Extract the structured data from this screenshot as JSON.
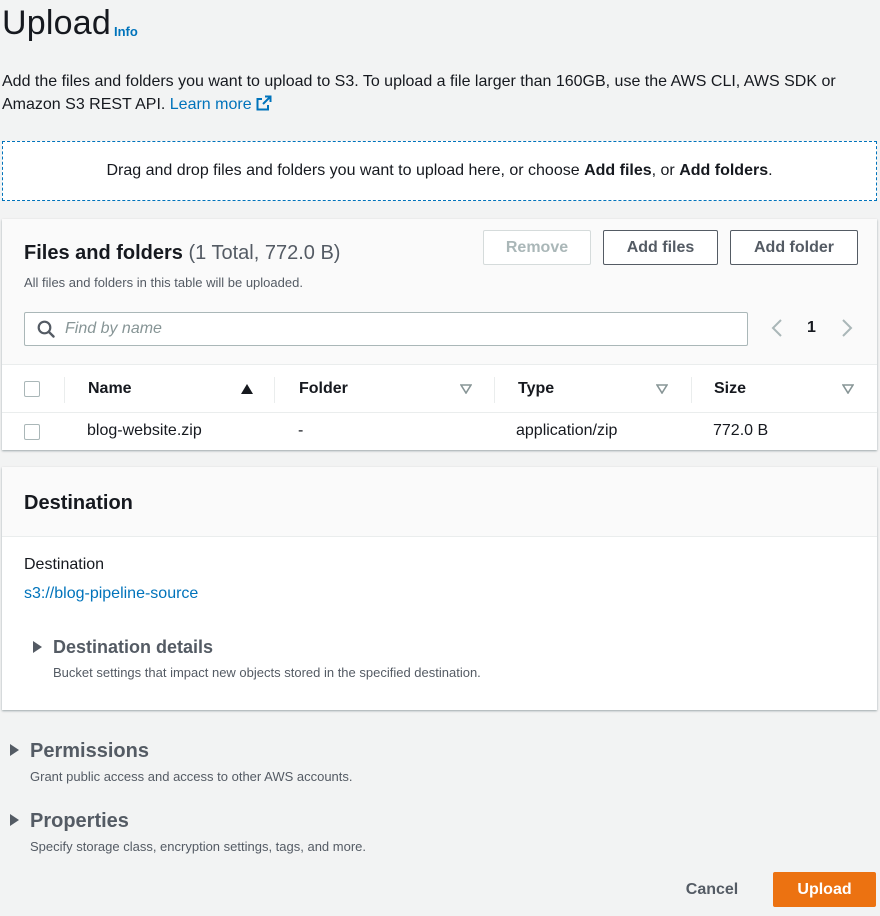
{
  "header": {
    "title": "Upload",
    "info_label": "Info"
  },
  "intro": {
    "text": "Add the files and folders you want to upload to S3. To upload a file larger than 160GB, use the AWS CLI, AWS SDK or Amazon S3 REST API. ",
    "learn_more": "Learn more"
  },
  "dropzone": {
    "text_before": "Drag and drop files and folders you want to upload here, or choose ",
    "add_files": "Add files",
    "text_middle": ", or ",
    "add_folders": "Add folders",
    "text_after": "."
  },
  "files_panel": {
    "title": "Files and folders",
    "count": "(1 Total, 772.0 B)",
    "description": "All files and folders in this table will be uploaded.",
    "remove_label": "Remove",
    "add_files_label": "Add files",
    "add_folder_label": "Add folder",
    "search_placeholder": "Find by name",
    "page_number": "1",
    "columns": [
      "Name",
      "Folder",
      "Type",
      "Size"
    ],
    "rows": [
      {
        "name": "blog-website.zip",
        "folder": "-",
        "type": "application/zip",
        "size": "772.0 B"
      }
    ]
  },
  "destination_panel": {
    "title": "Destination",
    "label": "Destination",
    "value": "s3://blog-pipeline-source",
    "details_title": "Destination details",
    "details_desc": "Bucket settings that impact new objects stored in the specified destination."
  },
  "permissions": {
    "title": "Permissions",
    "desc": "Grant public access and access to other AWS accounts."
  },
  "properties": {
    "title": "Properties",
    "desc": "Specify storage class, encryption settings, tags, and more."
  },
  "footer": {
    "cancel_label": "Cancel",
    "upload_label": "Upload"
  },
  "colors": {
    "link": "#0073bb",
    "primary_button": "#ec7211"
  }
}
